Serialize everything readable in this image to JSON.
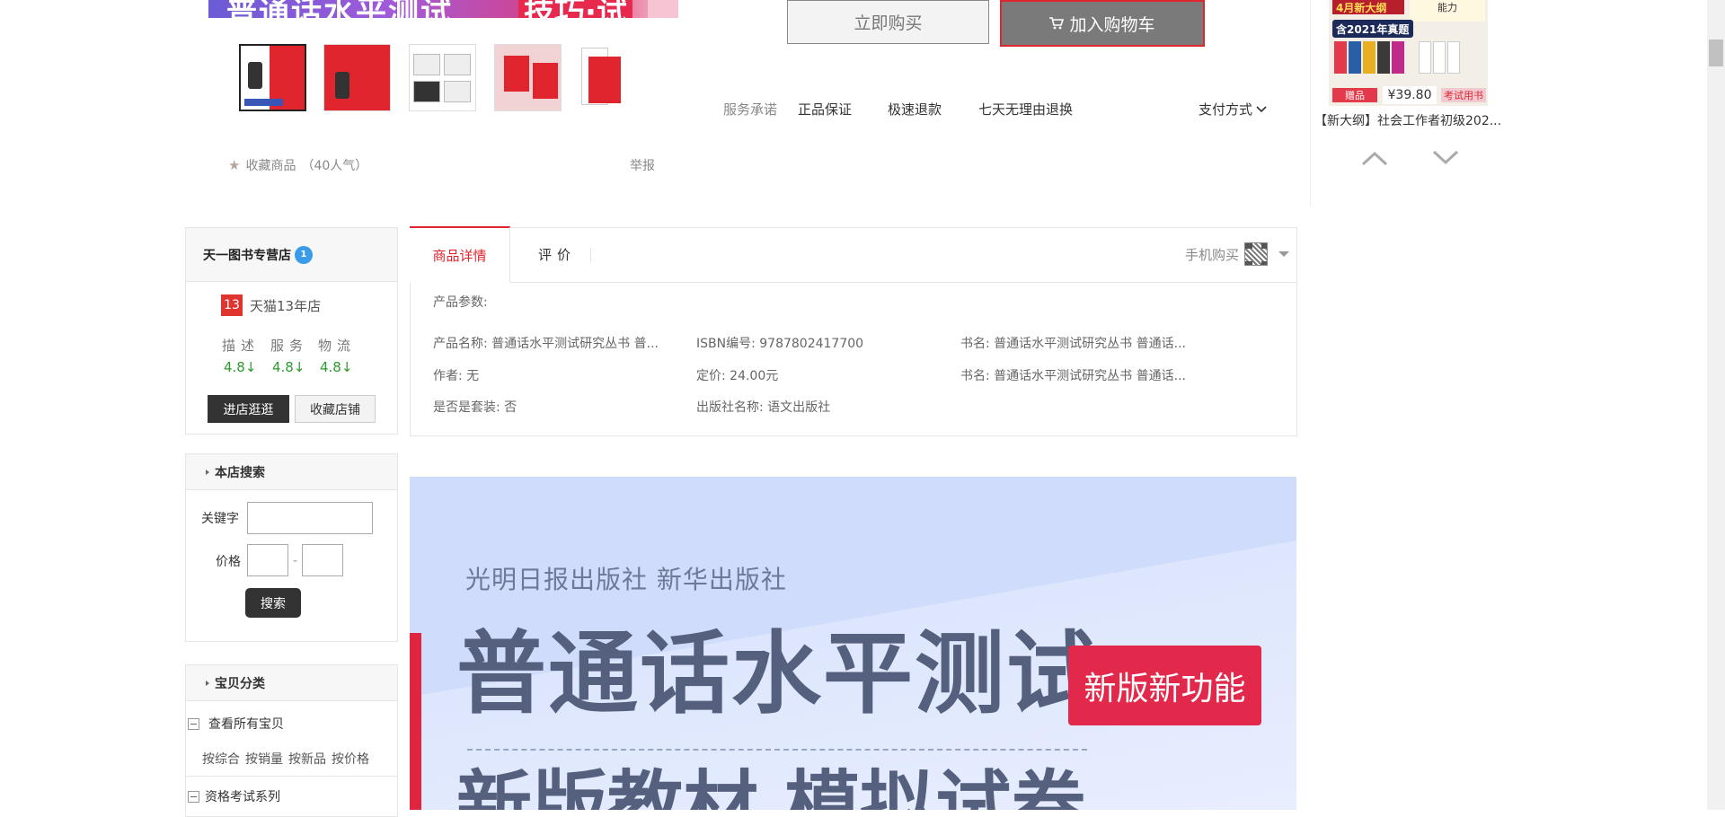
{
  "gallery": {
    "banner_text": "普通话水平测试",
    "banner_text2": "技巧·试"
  },
  "actions": {
    "buy_now": "立即购买",
    "add_to_cart": "加入购物车"
  },
  "service": {
    "label": "服务承诺",
    "items": [
      "正品保证",
      "极速退款",
      "七天无理由退换"
    ],
    "payment": "支付方式"
  },
  "favorite": {
    "label": "收藏商品",
    "count": "（40人气）",
    "report": "举报"
  },
  "side_recommend": {
    "badge1": "4月新大纲",
    "badge2": "含2021年真题",
    "top_text": "能力",
    "badge3": "赠品",
    "price": "¥39.80",
    "badge4": "考试用书",
    "title": "【新大纲】社会工作者初级202..."
  },
  "shop": {
    "name": "天一图书专营店",
    "badge": "1",
    "age_num": "13",
    "age_text": "天猫13年店",
    "ratings": [
      {
        "label": "描述",
        "value": "4.8"
      },
      {
        "label": "服务",
        "value": "4.8"
      },
      {
        "label": "物流",
        "value": "4.8"
      }
    ],
    "ratings_header": "描 述  服 务  物 流",
    "enter_btn": "进店逛逛",
    "fav_btn": "收藏店铺"
  },
  "store_search": {
    "title": "本店搜索",
    "keyword_label": "关键字",
    "price_label": "价格",
    "dash": "-",
    "search_btn": "搜索"
  },
  "categories": {
    "title": "宝贝分类",
    "all": "查看所有宝贝",
    "sort": [
      "按综合",
      "按销量",
      "按新品",
      "按价格"
    ],
    "series": "资格考试系列"
  },
  "detail": {
    "tabs": [
      "商品详情",
      "评价"
    ],
    "mobile_buy": "手机购买",
    "params_header": "产品参数:",
    "params": [
      "产品名称: 普通话水平测试研究丛书 普...",
      "ISBN编号: 9787802417700",
      "书名: 普通话水平测试研究丛书 普通话...",
      "作者: 无",
      "定价: 24.00元",
      "书名: 普通话水平测试研究丛书 普通话...",
      "是否是套装: 否",
      "出版社名称: 语文出版社"
    ]
  },
  "hero": {
    "publishers": "光明日报出版社  新华出版社",
    "title": "普通话水平测试",
    "badge": "新版新功能",
    "subtitle": "新版教材   模拟试卷"
  },
  "colors": {
    "accent": "#e0252f",
    "rating_green": "#2d9a2d",
    "hero_bg": "#cfdcfb"
  }
}
